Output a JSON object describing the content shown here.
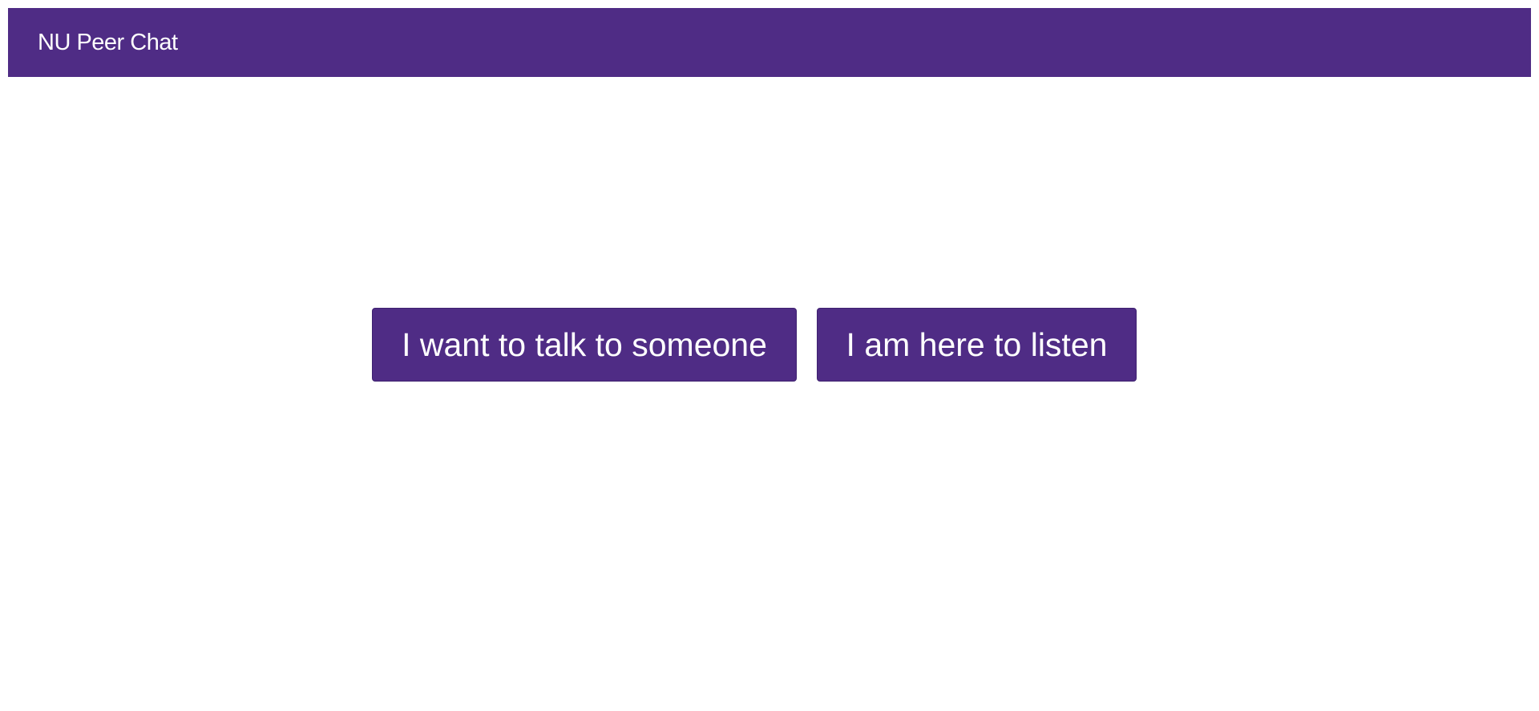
{
  "app": {
    "title": "NU Peer Chat",
    "brand_color": "#4f2c85"
  },
  "actions": {
    "talk_label": "I want to talk to someone",
    "listen_label": "I am here to listen"
  }
}
